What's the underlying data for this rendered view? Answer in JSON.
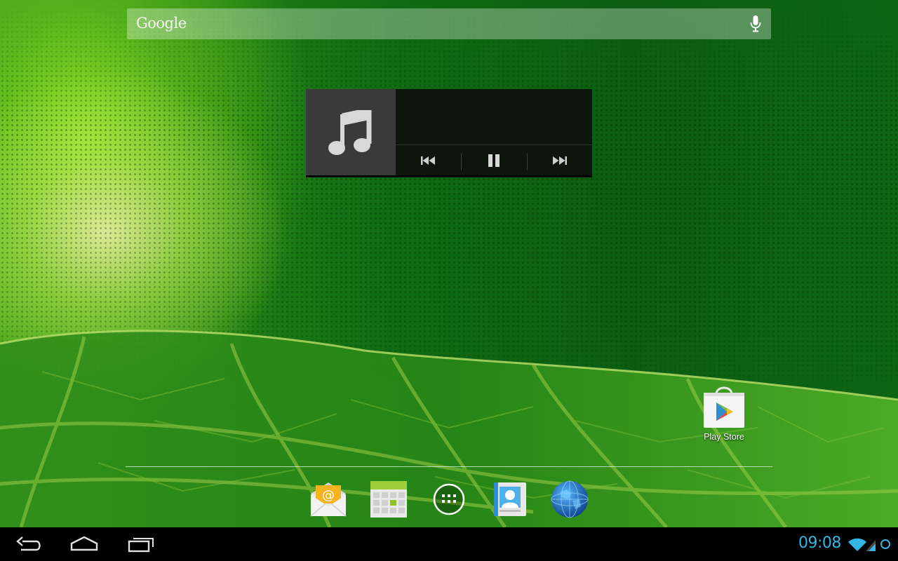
{
  "search": {
    "logo_text": "Google",
    "icon": "mic-icon"
  },
  "music_widget": {
    "album_icon": "music-note-icon",
    "controls": [
      {
        "name": "previous-button",
        "icon": "skip-previous-icon"
      },
      {
        "name": "pause-button",
        "icon": "pause-icon"
      },
      {
        "name": "next-button",
        "icon": "skip-next-icon"
      }
    ]
  },
  "desktop": {
    "shortcuts": [
      {
        "label": "Play Store",
        "icon": "play-store-icon"
      }
    ]
  },
  "hotseat": {
    "items": [
      {
        "name": "email-app",
        "icon": "email-icon"
      },
      {
        "name": "calendar-app",
        "icon": "calendar-icon"
      },
      {
        "name": "all-apps",
        "icon": "app-drawer-icon"
      },
      {
        "name": "contacts-app",
        "icon": "contacts-icon"
      },
      {
        "name": "browser-app",
        "icon": "globe-icon"
      }
    ]
  },
  "navbar": {
    "buttons": [
      "back",
      "home",
      "recent-apps"
    ],
    "clock": "09:08",
    "status_icons": [
      "wifi-icon",
      "signal-icon",
      "sync-icon"
    ],
    "accent_color": "#33b5e5"
  }
}
